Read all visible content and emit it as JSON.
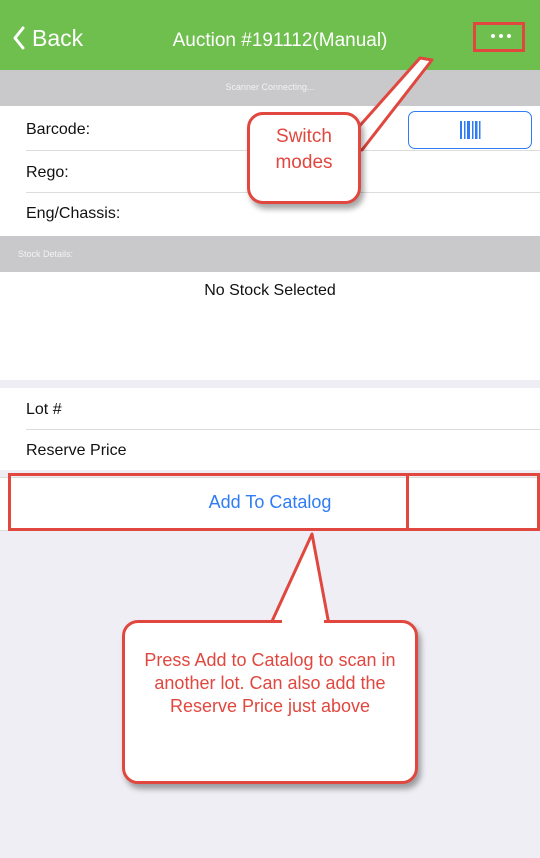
{
  "nav": {
    "back_label": "Back",
    "title": "Auction #191112(Manual)",
    "menu_icon": "ellipsis-icon"
  },
  "scanner_status": "Scanner Connecting...",
  "fields": {
    "barcode_label": "Barcode:",
    "rego_label": "Rego:",
    "eng_chassis_label": "Eng/Chassis:"
  },
  "stock": {
    "section_label": "Stock Details:",
    "empty_text": "No Stock Selected"
  },
  "lot": {
    "lot_label": "Lot #",
    "reserve_label": "Reserve Price"
  },
  "actions": {
    "add_to_catalog_label": "Add To Catalog"
  },
  "annotations": {
    "switch_modes_line1": "Switch",
    "switch_modes_line2": "modes",
    "add_catalog_help": "Press Add to Catalog to scan in another lot. Can also add the Reserve Price just above"
  },
  "colors": {
    "nav_green": "#6fbf4f",
    "ios_blue": "#2f7cf6",
    "annotation_red": "#e0473f"
  }
}
